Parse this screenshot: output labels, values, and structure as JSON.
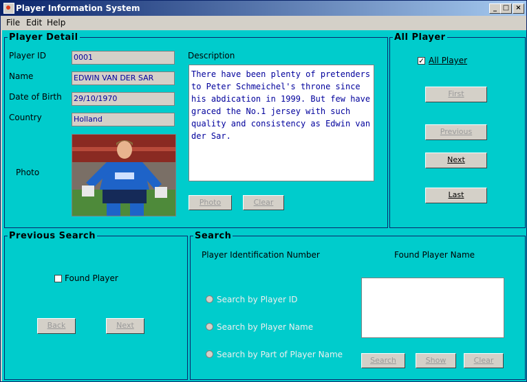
{
  "window": {
    "title": "Player Information System"
  },
  "menu": {
    "items": [
      "File",
      "Edit",
      "Help"
    ]
  },
  "player_detail": {
    "title": "Player Detail",
    "id_label": "Player ID",
    "id_value": "0001",
    "name_label": "Name",
    "name_value": "EDWIN VAN DER SAR",
    "dob_label": "Date of Birth",
    "dob_value": "29/10/1970",
    "country_label": "Country",
    "country_value": "Holland",
    "photo_label": "Photo",
    "description_label": "Description",
    "description_text": "There have been plenty of pretenders to Peter Schmeichel's throne since his abdication in 1999. But few have graced the No.1 jersey with such quality and consistency as Edwin van der Sar.",
    "photo_button": "Photo",
    "clear_button": "Clear"
  },
  "all_player": {
    "title": "All Player",
    "checkbox_label": "All Player",
    "checked": true,
    "first_button": "First",
    "previous_button": "Previous",
    "next_button": "Next",
    "last_button": "Last"
  },
  "previous_search": {
    "title": "Previous Search",
    "checkbox_label": "Found Player",
    "checked": false,
    "back_button": "Back",
    "next_button": "Next"
  },
  "search": {
    "title": "Search",
    "id_header": "Player Identification Number",
    "found_header": "Found Player Name",
    "radio_by_id": "Search by Player ID",
    "radio_by_name": "Search by Player Name",
    "radio_by_part": "Search by Part of Player Name",
    "search_button": "Search",
    "show_button": "Show",
    "clear_button": "Clear"
  },
  "colors": {
    "panel": "#00cccc",
    "field_text": "#00009c",
    "titlebar": "#0a246a"
  }
}
